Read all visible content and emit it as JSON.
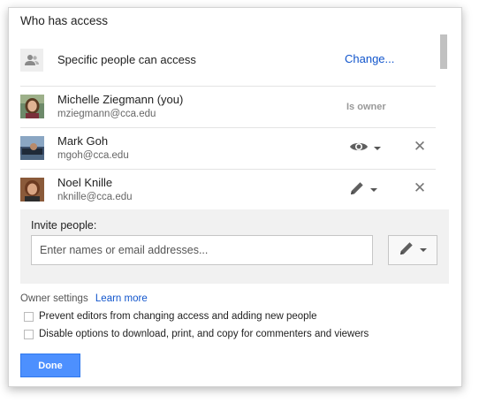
{
  "dialog": {
    "title": "Who has access"
  },
  "general_access": {
    "icon": "person-icon",
    "label": "Specific people can access",
    "change_label": "Change..."
  },
  "people": [
    {
      "name": "Michelle Ziegmann (you)",
      "email": "mziegmann@cca.edu",
      "role_label": "Is owner",
      "avatar": "avatar-photo"
    },
    {
      "name": "Mark Goh",
      "email": "mgoh@cca.edu",
      "permission_icon": "eye-icon",
      "remove_icon": "close-icon",
      "avatar": "avatar-photo"
    },
    {
      "name": "Noel Knille",
      "email": "nknille@cca.edu",
      "permission_icon": "pencil-icon",
      "remove_icon": "close-icon",
      "avatar": "avatar-photo"
    }
  ],
  "invite": {
    "label": "Invite people:",
    "placeholder": "Enter names or email addresses...",
    "permission_icon": "pencil-icon"
  },
  "owner_settings": {
    "label": "Owner settings",
    "learn_more": "Learn more",
    "options": [
      {
        "label": "Prevent editors from changing access and adding new people",
        "checked": false
      },
      {
        "label": "Disable options to download, print, and copy for commenters and viewers",
        "checked": false
      }
    ]
  },
  "actions": {
    "done_label": "Done"
  },
  "colors": {
    "link": "#1155cc",
    "primary_button": "#4d90fe",
    "panel_bg": "#f1f1f1"
  }
}
